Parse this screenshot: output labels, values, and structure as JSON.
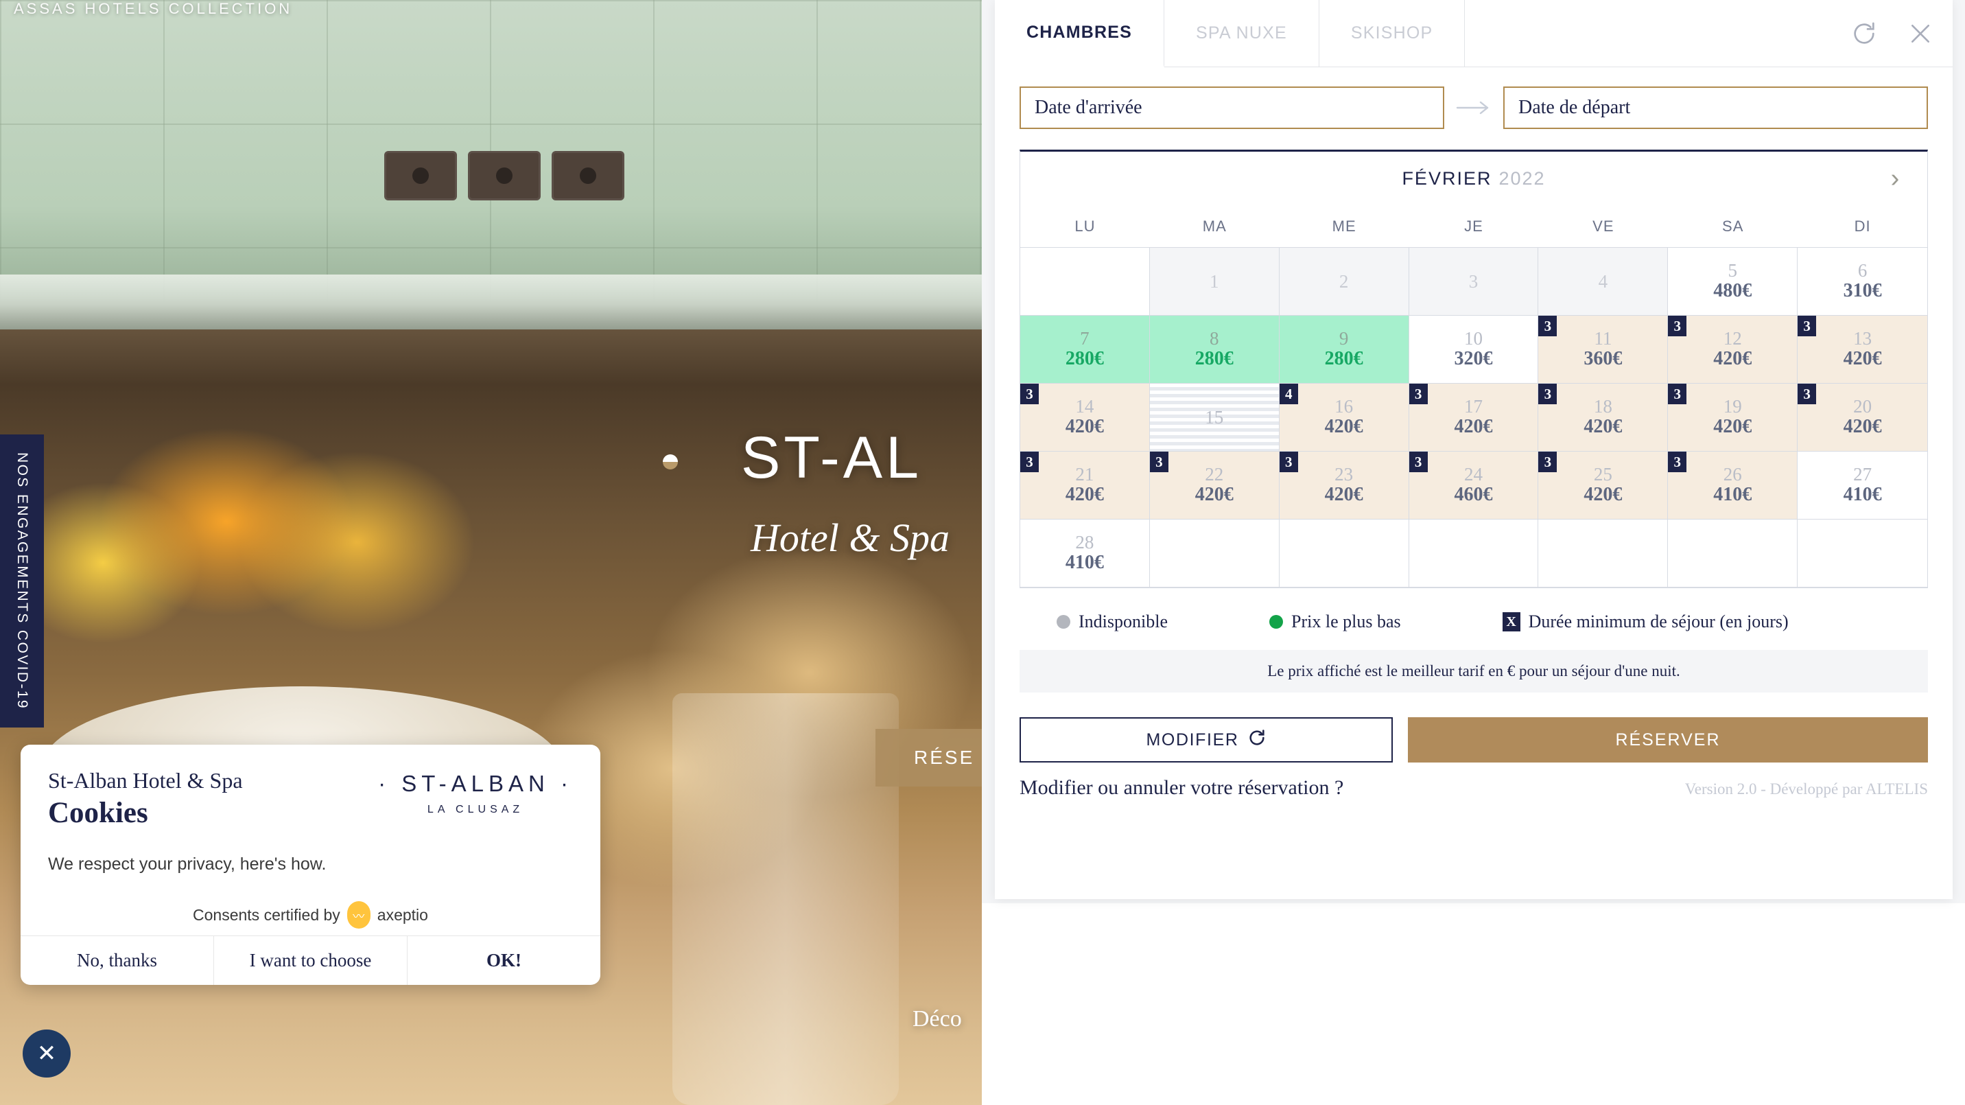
{
  "site": {
    "brand": "ASSAS HOTELS COLLECTION",
    "covid_tab": "NOS ENGAGEMENTS COVID-19",
    "hero_title": "ST-AL",
    "hero_subtitle": "Hotel & Spa",
    "hero_cta": "RÉSE",
    "hero_discover": "Déco",
    "close_fab": "✕"
  },
  "cookies": {
    "hotel_name": "St-Alban Hotel & Spa",
    "heading": "Cookies",
    "description": "We respect your privacy, here's how.",
    "certified_prefix": "Consents certified by",
    "certified_brand": "axeptio",
    "logo_line1": "· ST-ALBAN ·",
    "logo_line2": "LA CLUSAZ",
    "actions": [
      {
        "label": "No, thanks",
        "primary": false
      },
      {
        "label": "I want to choose",
        "primary": false
      },
      {
        "label": "OK!",
        "primary": true
      }
    ]
  },
  "booking": {
    "tabs": [
      {
        "label": "CHAMBRES",
        "active": true
      },
      {
        "label": "SPA NUXE",
        "active": false
      },
      {
        "label": "SKISHOP",
        "active": false
      }
    ],
    "tools": [
      {
        "name": "refresh-icon"
      },
      {
        "name": "close-icon"
      }
    ],
    "dates": {
      "arrival_placeholder": "Date d'arrivée",
      "arrival_value": "Date d'arrivée",
      "departure_placeholder": "Date de départ",
      "departure_value": "Date de départ"
    },
    "calendar": {
      "month": "FÉVRIER",
      "year": "2022",
      "next_label": "›",
      "dows": [
        "LU",
        "MA",
        "ME",
        "JE",
        "VE",
        "SA",
        "DI"
      ],
      "cells": [
        {
          "state": "empty"
        },
        {
          "day": "1",
          "state": "past"
        },
        {
          "day": "2",
          "state": "past"
        },
        {
          "day": "3",
          "state": "past"
        },
        {
          "day": "4",
          "state": "past"
        },
        {
          "day": "5",
          "price": "480€",
          "state": "available"
        },
        {
          "day": "6",
          "price": "310€",
          "state": "available"
        },
        {
          "day": "7",
          "price": "280€",
          "state": "best"
        },
        {
          "day": "8",
          "price": "280€",
          "state": "best"
        },
        {
          "day": "9",
          "price": "280€",
          "state": "best"
        },
        {
          "day": "10",
          "price": "320€",
          "state": "available"
        },
        {
          "day": "11",
          "price": "360€",
          "state": "offer",
          "min_stay": "3"
        },
        {
          "day": "12",
          "price": "420€",
          "state": "offer",
          "min_stay": "3"
        },
        {
          "day": "13",
          "price": "420€",
          "state": "offer",
          "min_stay": "3"
        },
        {
          "day": "14",
          "price": "420€",
          "state": "offer",
          "min_stay": "3"
        },
        {
          "day": "15",
          "state": "unavailable"
        },
        {
          "day": "16",
          "price": "420€",
          "state": "offer",
          "min_stay": "4"
        },
        {
          "day": "17",
          "price": "420€",
          "state": "offer",
          "min_stay": "3"
        },
        {
          "day": "18",
          "price": "420€",
          "state": "offer",
          "min_stay": "3"
        },
        {
          "day": "19",
          "price": "420€",
          "state": "offer",
          "min_stay": "3"
        },
        {
          "day": "20",
          "price": "420€",
          "state": "offer",
          "min_stay": "3"
        },
        {
          "day": "21",
          "price": "420€",
          "state": "offer",
          "min_stay": "3"
        },
        {
          "day": "22",
          "price": "420€",
          "state": "offer",
          "min_stay": "3"
        },
        {
          "day": "23",
          "price": "420€",
          "state": "offer",
          "min_stay": "3"
        },
        {
          "day": "24",
          "price": "460€",
          "state": "offer",
          "min_stay": "3"
        },
        {
          "day": "25",
          "price": "420€",
          "state": "offer",
          "min_stay": "3"
        },
        {
          "day": "26",
          "price": "410€",
          "state": "offer",
          "min_stay": "3"
        },
        {
          "day": "27",
          "price": "410€",
          "state": "available"
        },
        {
          "day": "28",
          "price": "410€",
          "state": "available"
        },
        {
          "state": "empty"
        },
        {
          "state": "empty"
        },
        {
          "state": "empty"
        },
        {
          "state": "empty"
        },
        {
          "state": "empty"
        },
        {
          "state": "empty"
        }
      ]
    },
    "legend": [
      {
        "marker": "grey-dot",
        "label": "Indisponible"
      },
      {
        "marker": "green-dot",
        "label": "Prix le plus bas"
      },
      {
        "marker": "x-square",
        "marker_text": "X",
        "label": "Durée minimum de séjour (en jours)"
      }
    ],
    "price_note": "Le prix affiché est le meilleur tarif en € pour un séjour d'une nuit.",
    "buttons": {
      "modify": "MODIFIER",
      "reserve": "RÉSERVER"
    },
    "modify_cancel_link": "Modifier ou annuler votre réservation ?",
    "version_note": "Version 2.0 - Développé par ALTELIS"
  },
  "colors": {
    "navy": "#1e2348",
    "gold": "#b08b5b",
    "best_green_bg": "#a6f0cd",
    "best_green_text": "#17a864",
    "offer_beige": "#f6ecdf",
    "muted": "#b9bdc7"
  }
}
